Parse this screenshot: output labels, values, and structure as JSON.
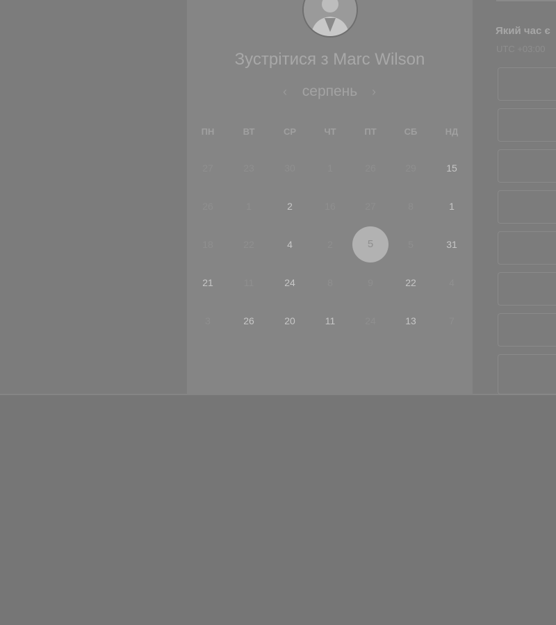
{
  "header": {
    "title": "Зустрітися з Marc Wilson",
    "avatar_alt": "Marc Wilson"
  },
  "calendar": {
    "month": "серпень",
    "prev_icon": "‹",
    "next_icon": "›",
    "weekdays": [
      "ПН",
      "ВТ",
      "СР",
      "ЧТ",
      "ПТ",
      "СБ",
      "НД"
    ],
    "weeks": [
      [
        {
          "d": "27",
          "a": false
        },
        {
          "d": "23",
          "a": false
        },
        {
          "d": "30",
          "a": false
        },
        {
          "d": "1",
          "a": false
        },
        {
          "d": "26",
          "a": false
        },
        {
          "d": "29",
          "a": false
        },
        {
          "d": "15",
          "a": true
        }
      ],
      [
        {
          "d": "26",
          "a": false
        },
        {
          "d": "1",
          "a": false
        },
        {
          "d": "2",
          "a": true
        },
        {
          "d": "16",
          "a": false
        },
        {
          "d": "27",
          "a": false
        },
        {
          "d": "8",
          "a": false
        },
        {
          "d": "1",
          "a": true
        }
      ],
      [
        {
          "d": "18",
          "a": false
        },
        {
          "d": "22",
          "a": false
        },
        {
          "d": "4",
          "a": true
        },
        {
          "d": "2",
          "a": false
        },
        {
          "d": "5",
          "a": true,
          "selected": true
        },
        {
          "d": "5",
          "a": false
        },
        {
          "d": "31",
          "a": true
        }
      ],
      [
        {
          "d": "21",
          "a": true
        },
        {
          "d": "11",
          "a": false
        },
        {
          "d": "24",
          "a": true
        },
        {
          "d": "8",
          "a": false
        },
        {
          "d": "9",
          "a": false
        },
        {
          "d": "22",
          "a": true
        },
        {
          "d": "4",
          "a": false
        }
      ],
      [
        {
          "d": "3",
          "a": false
        },
        {
          "d": "26",
          "a": true
        },
        {
          "d": "20",
          "a": true
        },
        {
          "d": "11",
          "a": true
        },
        {
          "d": "24",
          "a": false
        },
        {
          "d": "13",
          "a": true
        },
        {
          "d": "7",
          "a": false
        }
      ]
    ]
  },
  "time_panel": {
    "heading": "Який час є",
    "timezone": "UTC +03:00",
    "slot_count": 8
  },
  "colors": {
    "overlay": "#7c7c7c",
    "card": "#858585",
    "selected_day": "#b2b2b2"
  }
}
